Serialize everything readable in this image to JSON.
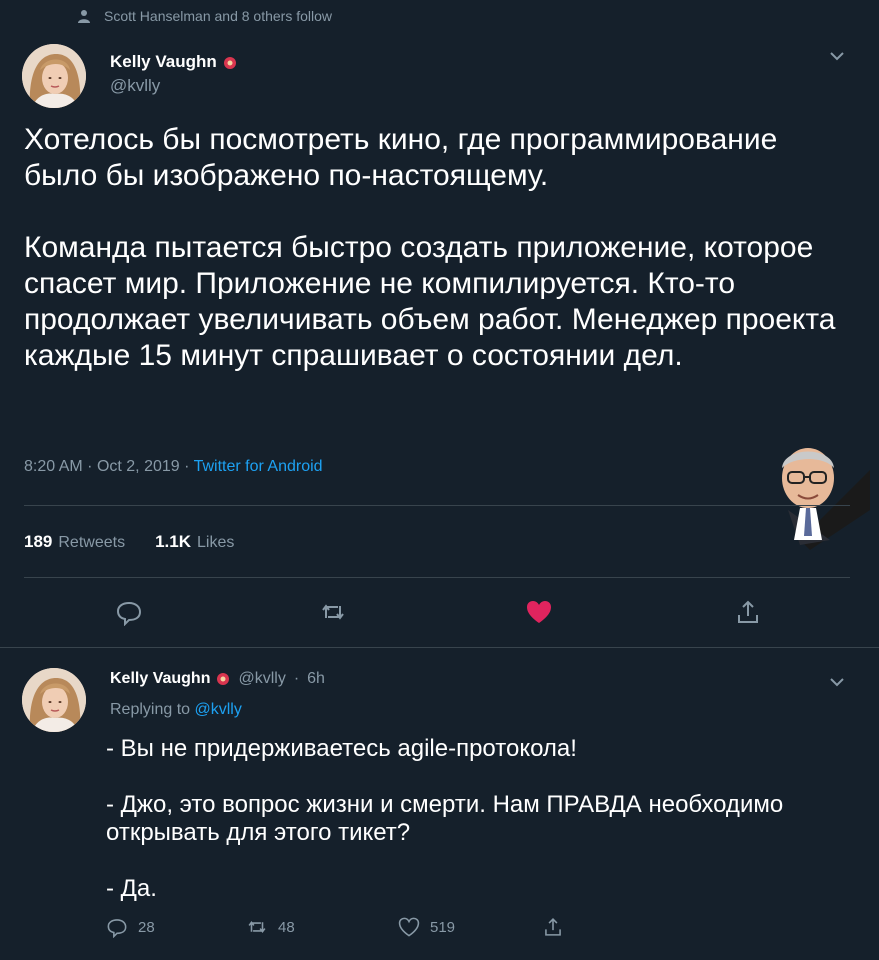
{
  "social_context": {
    "text": "Scott Hanselman and 8 others follow",
    "icon": "person-icon"
  },
  "main_tweet": {
    "author": {
      "name": "Kelly Vaughn",
      "handle": "@kvlly",
      "badge_icon": "flower-emoji-icon"
    },
    "text": [
      "Хотелось бы посмотреть кино, где программирование было бы изображено по-настоящему.",
      "Команда пытается быстро создать приложение, которое спасет мир. Приложение не компилируется. Кто-то продолжает увеличивать объем работ. Менеджер проекта каждые 15 минут спрашивает о состоянии дел."
    ],
    "meta": {
      "time": "8:20 AM",
      "sep1": "·",
      "date": "Oct 2, 2019",
      "sep2": "·",
      "source": "Twitter for Android"
    },
    "stats": {
      "retweets_count": "189",
      "retweets_label": "Retweets",
      "likes_count": "1.1K",
      "likes_label": "Likes"
    },
    "actions": [
      "reply-icon",
      "retweet-icon",
      "heart-filled-icon",
      "share-icon"
    ],
    "colors": {
      "liked": "#e0245e",
      "icon": "#8899a6"
    }
  },
  "reply": {
    "author": {
      "name": "Kelly Vaughn",
      "handle": "@kvlly",
      "dot": "·",
      "time": "6h"
    },
    "replying_prefix": "Replying to",
    "replying_handle": "@kvlly",
    "text": [
      "- Вы не придерживаетесь agile-протокола!",
      "- Джо, это вопрос жизни и смерти. Нам ПРАВДА необходимо открывать для этого тикет?",
      "- Да."
    ],
    "counts": {
      "replies": "28",
      "retweets": "48",
      "likes": "519"
    }
  },
  "colors": {
    "background": "#15202b",
    "text": "#ffffff",
    "muted": "#8899a6",
    "accent": "#1da1f2",
    "divider": "#38444d"
  }
}
